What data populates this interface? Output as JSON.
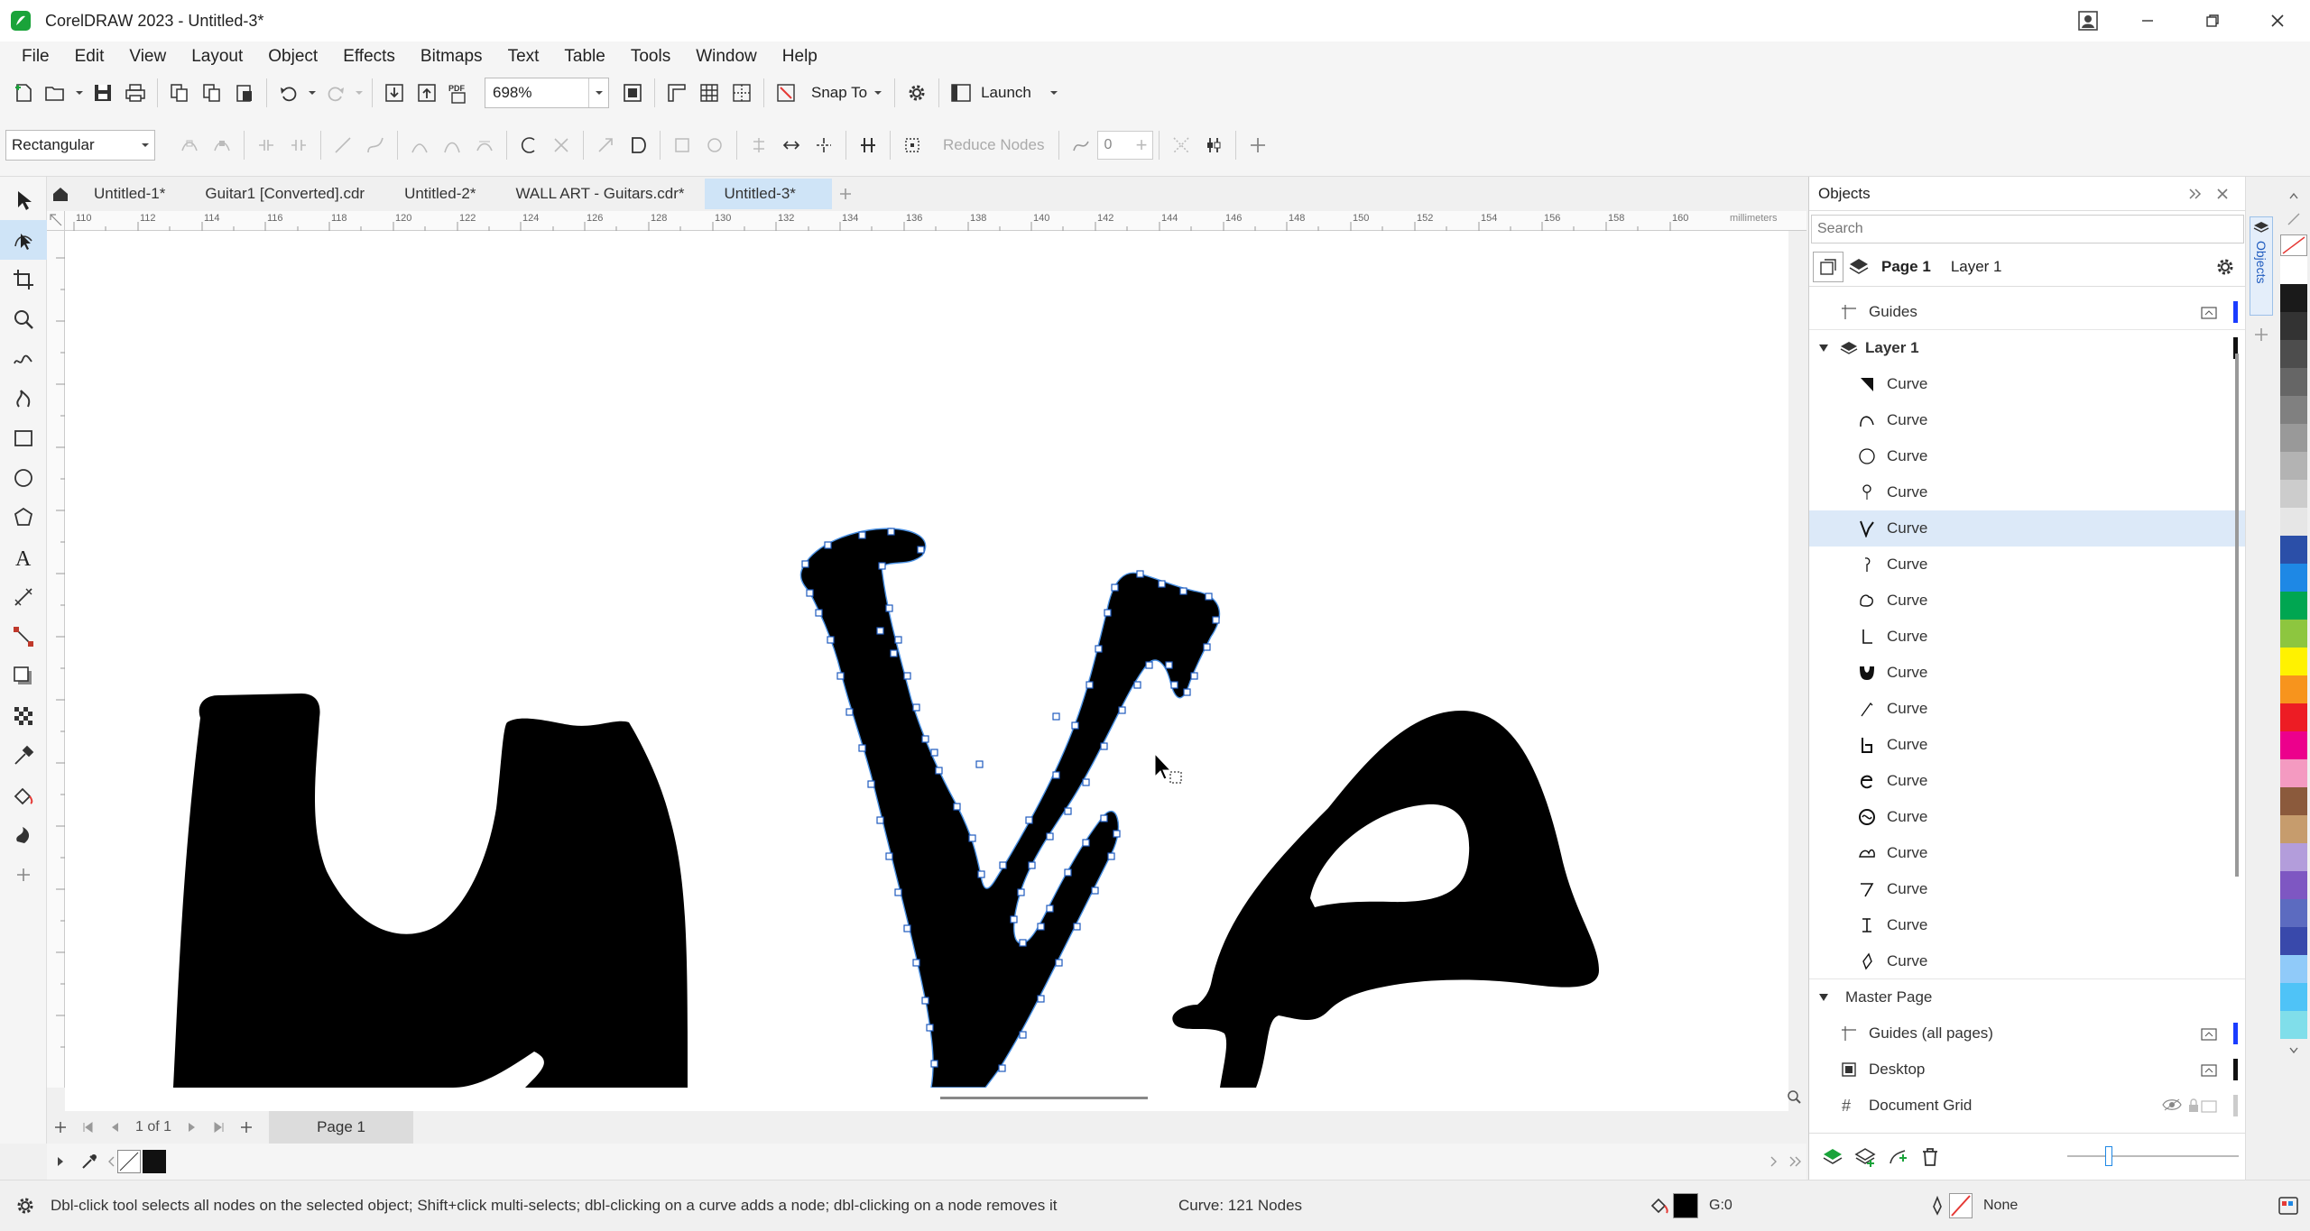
{
  "window": {
    "title": "CorelDRAW 2023 - Untitled-3*"
  },
  "menu": [
    "File",
    "Edit",
    "View",
    "Layout",
    "Object",
    "Effects",
    "Bitmaps",
    "Text",
    "Table",
    "Tools",
    "Window",
    "Help"
  ],
  "toolbar": {
    "zoom_value": "698%",
    "snap_label": "Snap To",
    "launch_label": "Launch"
  },
  "property_bar": {
    "shape_mode": "Rectangular",
    "reduce_nodes_label": "Reduce Nodes",
    "smoothness_value": "0"
  },
  "doc_tabs": [
    {
      "label": "Untitled-1*",
      "active": false
    },
    {
      "label": "Guitar1 [Converted].cdr",
      "active": false
    },
    {
      "label": "Untitled-2*",
      "active": false
    },
    {
      "label": "WALL ART - Guitars.cdr*",
      "active": false
    },
    {
      "label": "Untitled-3*",
      "active": true
    }
  ],
  "ruler": {
    "h_ticks": [
      "110",
      "112",
      "114",
      "116",
      "118",
      "120",
      "122",
      "124",
      "126",
      "128",
      "130",
      "132",
      "134",
      "136",
      "138",
      "140",
      "142",
      "144",
      "146",
      "148",
      "150",
      "152",
      "154",
      "156",
      "158",
      "160"
    ],
    "unit": "millimeters"
  },
  "page_nav": {
    "counter": "1 of 1",
    "page_tab": "Page 1"
  },
  "status": {
    "hint": "Dbl-click tool selects all nodes on the selected object; Shift+click multi-selects; dbl-clicking on a curve adds a node; dbl-clicking on a node removes it",
    "info": "Curve: 121 Nodes",
    "fill_label": "G:0",
    "outline_label": "None"
  },
  "objects_panel": {
    "title": "Objects",
    "search_placeholder": "Search",
    "page_label": "Page 1",
    "layer_label": "Layer 1",
    "guides_label": "Guides",
    "layer1_label": "Layer 1",
    "curves": [
      "Curve",
      "Curve",
      "Curve",
      "Curve",
      "Curve",
      "Curve",
      "Curve",
      "Curve",
      "Curve",
      "Curve",
      "Curve",
      "Curve",
      "Curve",
      "Curve",
      "Curve",
      "Curve",
      "Curve"
    ],
    "selected_index": 4,
    "master_page_label": "Master Page",
    "master_items": [
      "Guides (all pages)",
      "Desktop",
      "Document Grid"
    ],
    "side_tab": "Objects"
  },
  "palette_colors": [
    "#ffffff",
    "#1a1a1a",
    "#333333",
    "#4d4d4d",
    "#666666",
    "#808080",
    "#999999",
    "#b3b3b3",
    "#cccccc",
    "#e6e6e6",
    "#2b4fa8",
    "#1e88e5",
    "#00a651",
    "#8dc63f",
    "#fff200",
    "#f7941d",
    "#ed1c24",
    "#ec008c",
    "#f49ac1",
    "#8b5a3c",
    "#c69c6d",
    "#b39ddb",
    "#7e57c2",
    "#5c6bc0",
    "#3949ab",
    "#90caf9",
    "#4fc3f7",
    "#80deea"
  ]
}
